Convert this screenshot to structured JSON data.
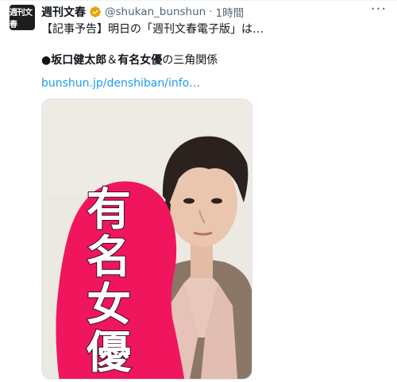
{
  "tweet": {
    "author_name": "週刊文春",
    "avatar_text": "週刊文春",
    "handle": "@shukan_bunshun",
    "separator": "·",
    "time": "1時間",
    "line1": "【記事予告】明日の「週刊文春電子版」は…",
    "line2_bullet": "●",
    "line2_name1": "坂口健太郎",
    "line2_amp": "＆",
    "line2_name2": "有名女優",
    "line2_tail": "の三角関係",
    "link": "bunshun.jp/denshiban/info…"
  },
  "media": {
    "stamp_chars": [
      "有",
      "名",
      "女",
      "優"
    ]
  },
  "colors": {
    "link": "#1d9bf0",
    "verified": "#e8a200",
    "blob": "#f0165e"
  }
}
